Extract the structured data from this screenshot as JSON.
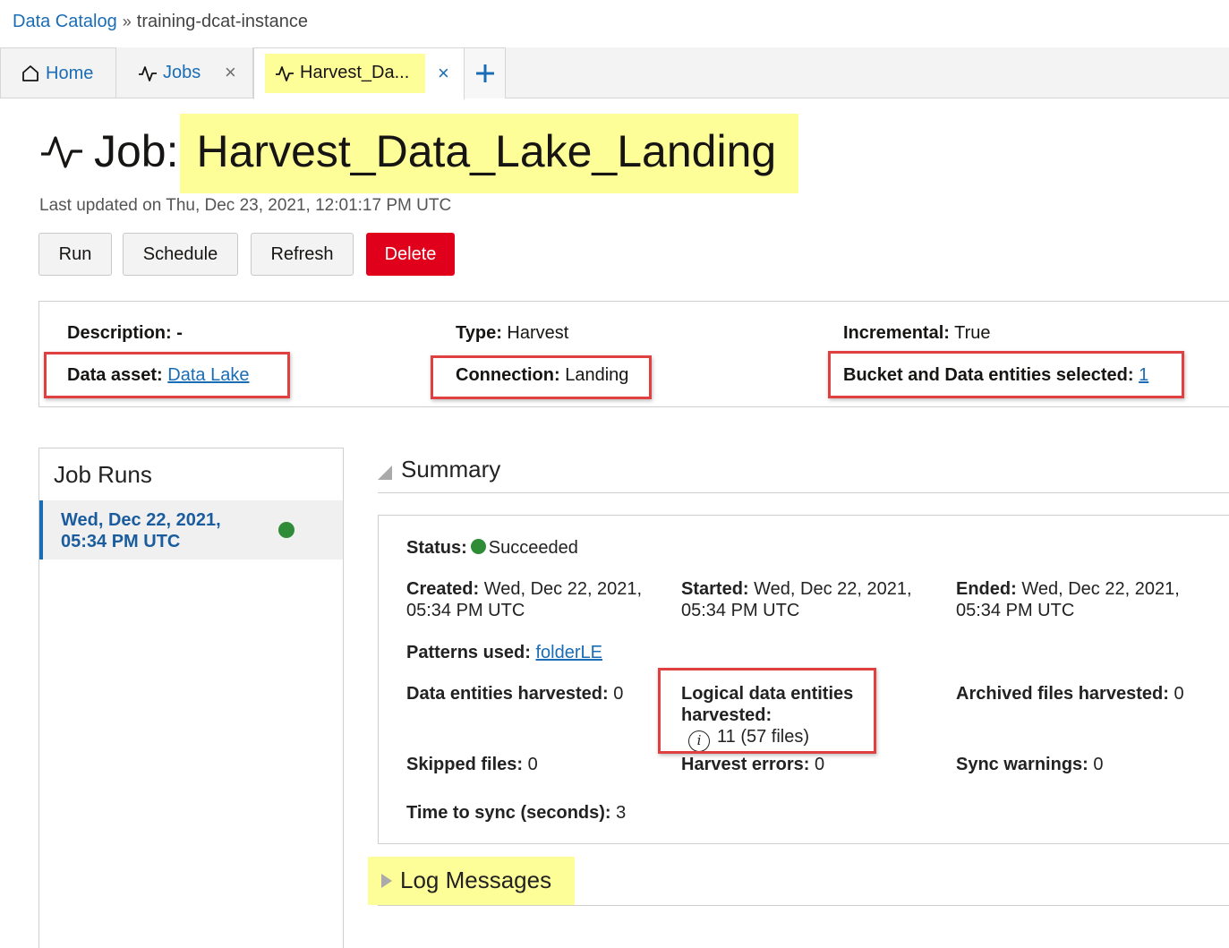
{
  "breadcrumb": {
    "root": "Data Catalog",
    "separator": "»",
    "current": "training-dcat-instance"
  },
  "tabs": {
    "home": "Home",
    "jobs": "Jobs",
    "active": "Harvest_Da...",
    "close_glyph": "×",
    "add_glyph": "+"
  },
  "header": {
    "prefix": "Job:",
    "title": "Harvest_Data_Lake_Landing",
    "last_updated": "Last updated on Thu, Dec 23, 2021, 12:01:17 PM UTC"
  },
  "actions": {
    "run": "Run",
    "schedule": "Schedule",
    "refresh": "Refresh",
    "delete": "Delete"
  },
  "details": {
    "description_label": "Description:",
    "description_value": "-",
    "type_label": "Type:",
    "type_value": "Harvest",
    "incremental_label": "Incremental:",
    "incremental_value": "True",
    "data_asset_label": "Data asset:",
    "data_asset_value": "Data Lake",
    "connection_label": "Connection:",
    "connection_value": "Landing",
    "bucket_label": "Bucket and Data entities selected:",
    "bucket_value": "1"
  },
  "job_runs": {
    "title": "Job Runs",
    "runs": [
      {
        "line1": "Wed, Dec 22, 2021,",
        "line2": "05:34 PM UTC",
        "status_color": "#2e8b36"
      }
    ]
  },
  "summary": {
    "title": "Summary",
    "status_label": "Status:",
    "status_value": "Succeeded",
    "created_label": "Created:",
    "created_line1": "Wed, Dec 22, 2021,",
    "created_line2": "05:34 PM UTC",
    "started_label": "Started:",
    "started_line1": "Wed, Dec 22, 2021,",
    "started_line2": "05:34 PM UTC",
    "ended_label": "Ended:",
    "ended_line1": "Wed, Dec 22, 2021,",
    "ended_line2": "05:34 PM UTC",
    "patterns_label": "Patterns used:",
    "patterns_value": "folderLE",
    "data_entities_label": "Data entities harvested:",
    "data_entities_value": "0",
    "logical_label_line1": "Logical data entities",
    "logical_label_line2": "harvested:",
    "logical_value": "11 (57 files)",
    "archived_label": "Archived files harvested:",
    "archived_value": "0",
    "skipped_label": "Skipped files:",
    "skipped_value": "0",
    "errors_label": "Harvest errors:",
    "errors_value": "0",
    "sync_warnings_label": "Sync warnings:",
    "sync_warnings_value": "0",
    "time_to_sync_label": "Time to sync (seconds):",
    "time_to_sync_value": "3"
  },
  "log_messages": {
    "title": "Log Messages"
  },
  "colors": {
    "link": "#1a6db5",
    "highlight": "#fefe99",
    "annotation_box": "#e0403f",
    "delete": "#e0001b",
    "success": "#2e8b36"
  },
  "icons": {
    "home": "home-icon",
    "activity": "activity-icon",
    "close": "close-icon",
    "add": "plus-icon",
    "info": "info-icon"
  }
}
